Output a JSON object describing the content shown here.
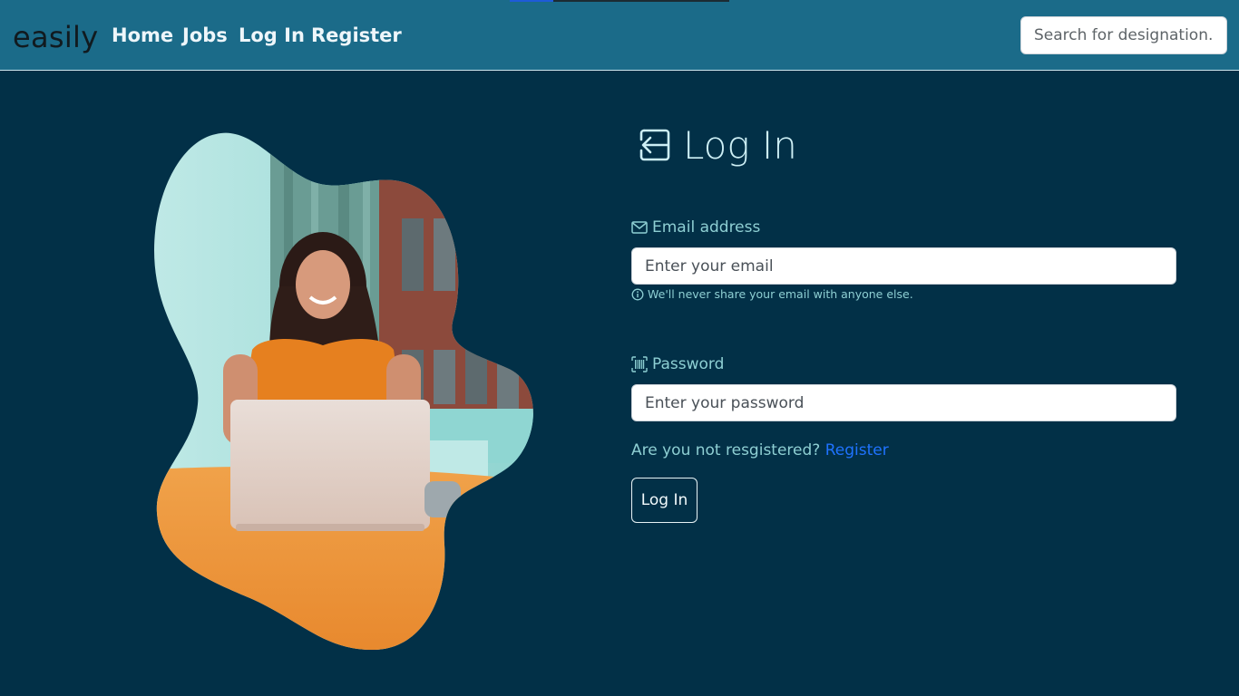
{
  "navbar": {
    "brand": "easily",
    "links": [
      "Home",
      "Jobs",
      "Log In",
      "Register"
    ],
    "search_placeholder": "Search for designation...."
  },
  "hero_image": {
    "description_icon": "woman-laptop-photo"
  },
  "login": {
    "title": "Log In",
    "title_icon": "box-arrow-in-left-icon",
    "email": {
      "label": "Email address",
      "icon": "envelope-icon",
      "placeholder": "Enter your email",
      "help": "We'll never share your email with anyone else.",
      "help_icon": "info-circle-icon"
    },
    "password": {
      "label": "Password",
      "icon": "upc-scan-icon",
      "placeholder": "Enter your password"
    },
    "register_prompt": "Are you not resgistered?",
    "register_link": "Register",
    "submit": "Log In"
  },
  "colors": {
    "background": "#023047",
    "navbar": "#1b6b89",
    "accent_text": "#8ecfd3",
    "link": "#1f73ff"
  }
}
